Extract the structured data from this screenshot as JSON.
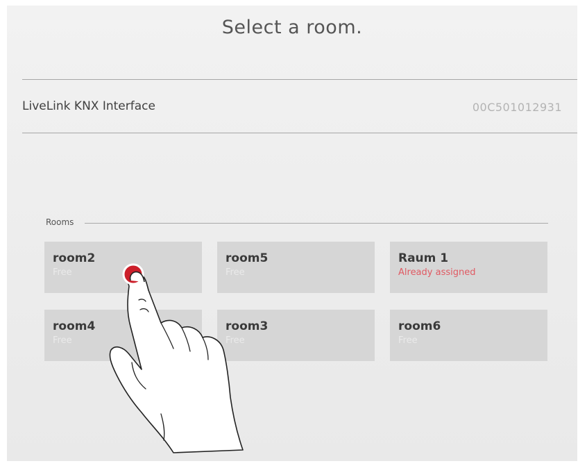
{
  "header": {
    "title": "Select a room."
  },
  "device": {
    "name": "LiveLink KNX Interface",
    "id": "00C501012931"
  },
  "rooms": {
    "section_label": "Rooms",
    "items": [
      {
        "name": "room2",
        "status": "Free",
        "state": "free"
      },
      {
        "name": "room5",
        "status": "Free",
        "state": "free"
      },
      {
        "name": "Raum 1",
        "status": "Already assigned",
        "state": "assigned"
      },
      {
        "name": "room4",
        "status": "Free",
        "state": "free"
      },
      {
        "name": "room3",
        "status": "Free",
        "state": "free"
      },
      {
        "name": "room6",
        "status": "Free",
        "state": "free"
      }
    ]
  },
  "colors": {
    "tile_bg": "#d6d6d6",
    "assigned_text": "#e05a63",
    "tap_indicator": "#cc1f2a"
  },
  "overlay": {
    "icon": "hand-pointer-icon"
  }
}
